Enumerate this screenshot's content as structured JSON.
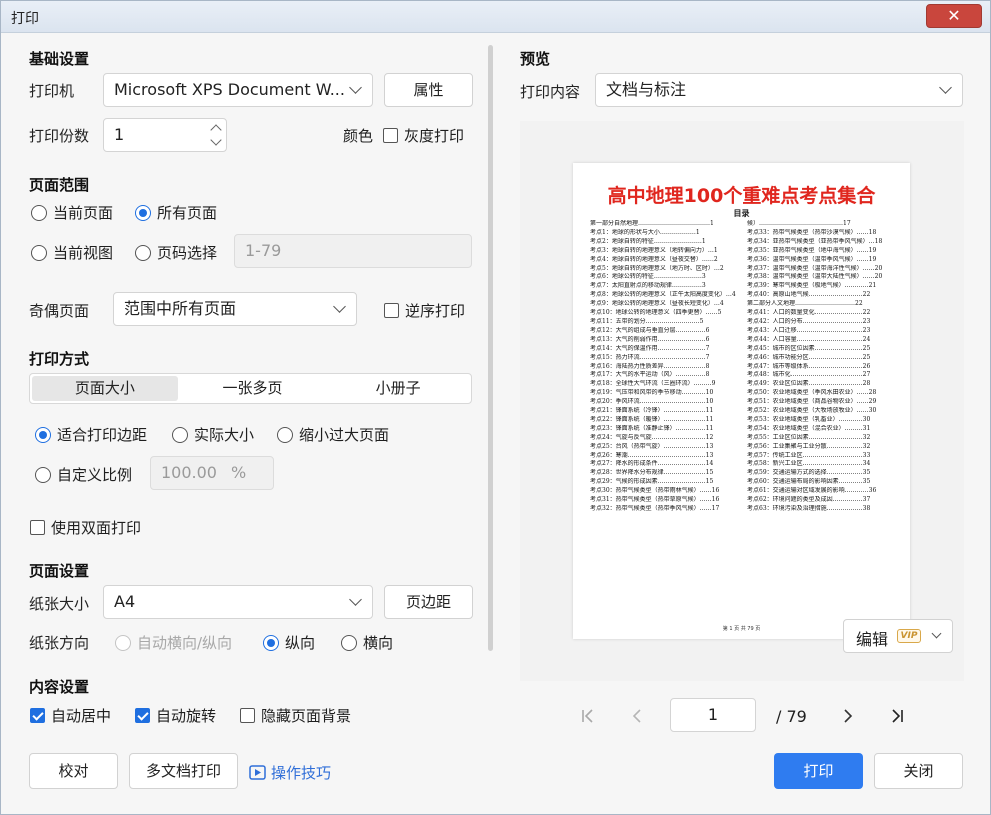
{
  "window": {
    "title": "打印",
    "close_glyph": "✕"
  },
  "basic": {
    "section_title": "基础设置",
    "printer_label": "打印机",
    "printer_value": "Microsoft XPS Document W...",
    "properties_button": "属性",
    "copies_label": "打印份数",
    "copies_value": "1",
    "color_label": "颜色",
    "grayscale_label": "灰度打印"
  },
  "range": {
    "section_title": "页面范围",
    "current_page": "当前页面",
    "all_pages": "所有页面",
    "current_view": "当前视图",
    "page_select": "页码选择",
    "page_select_value": "1-79",
    "odd_even_label": "奇偶页面",
    "odd_even_value": "范围中所有页面",
    "reverse_label": "逆序打印"
  },
  "mode": {
    "section_title": "打印方式",
    "tabs": [
      "页面大小",
      "一张多页",
      "小册子"
    ],
    "fit_margins": "适合打印边距",
    "actual_size": "实际大小",
    "shrink_large": "缩小过大页面",
    "custom_scale": "自定义比例",
    "custom_scale_value": "100.00",
    "percent_unit": "%",
    "duplex_label": "使用双面打印"
  },
  "page_setup": {
    "section_title": "页面设置",
    "paper_size_label": "纸张大小",
    "paper_size_value": "A4",
    "margins_button": "页边距",
    "orientation_label": "纸张方向",
    "auto_orient": "自动横向/纵向",
    "portrait": "纵向",
    "landscape": "横向"
  },
  "content": {
    "section_title": "内容设置",
    "auto_center": "自动居中",
    "auto_rotate": "自动旋转",
    "hide_background": "隐藏页面背景"
  },
  "footer_left": {
    "proof_button": "校对",
    "multi_doc_button": "多文档打印",
    "tips_link": "操作技巧"
  },
  "preview": {
    "section_title": "预览",
    "content_label": "打印内容",
    "content_value": "文档与标注",
    "doc_title": "高中地理100个重难点考点集合",
    "doc_subtitle": "目录",
    "toc_left": [
      "第一部分自然地理………………………………1",
      "考点1：地球的形状与大小………………1",
      "考点2：地球自转的特征……………………1",
      "考点3：地球自转的地理意义（地转偏向力）…1",
      "考点4：地球自转的地理意义（昼夜交替）……2",
      "考点5：地球自转的地理意义（地方时、区时）…2",
      "考点6：地球公转的特征……………………3",
      "考点7：太阳直射点的移动规律……………3",
      "考点8：地球公转的地理意义（正午太阳高度变化）…4",
      "考点9：地球公转的地理意义（昼夜长短变化）…4",
      "考点10：地球公转的地理意义（四季更替）……5",
      "考点11：五带的划分………………………5",
      "考点12：大气的组成与垂直分层……………6",
      "考点13：大气的削弱作用……………………6",
      "考点14：大气的保温作用……………………7",
      "考点15：热力环流……………………………7",
      "考点16：海陆热力性质差异…………………8",
      "考点17：大气的水平运动（风）……………8",
      "考点18：全球性大气环流（三圈环流）………9",
      "考点19：气压带和风带的季节移动…………10",
      "考点20：季风环流……………………………10",
      "考点21：锋面系统（冷锋）…………………11",
      "考点22：锋面系统（暖锋）…………………11",
      "考点23：锋面系统（准静止锋）……………11",
      "考点24：气旋与反气旋………………………12",
      "考点25：台风（热带气旋）…………………13",
      "考点26：寒潮…………………………………13",
      "考点27：降水的形成条件……………………14",
      "考点28：世界降水分布规律…………………15",
      "考点29：气候的形成因素……………………15",
      "考点30：热带气候类型（热带雨林气候）……16",
      "考点31：热带气候类型（热带草原气候）……16",
      "考点32：热带气候类型（热带季风气候）……17"
    ],
    "toc_right": [
      "候）……………………………………17",
      "考点33：热带气候类型（热带沙漠气候）……18",
      "考点34：亚热带气候类型（亚热带季风气候）…18",
      "考点35：亚热带气候类型（地中海气候）……19",
      "考点36：温带气候类型（温带季风气候）……19",
      "考点37：温带气候类型（温带海洋性气候）……20",
      "考点38：温带气候类型（温带大陆性气候）……20",
      "考点39：寒带气候类型（极地气候）…………21",
      "考点40：高原山地气候………………………22",
      "第二部分人文地理…………………………22",
      "考点41：人口的数量变化……………………22",
      "考点42：人口的分布…………………………23",
      "考点43：人口迁移……………………………23",
      "考点44：人口容量……………………………24",
      "考点45：城市的区位因素……………………25",
      "考点46：城市功能分区………………………25",
      "考点47：城市等级体系………………………26",
      "考点48：城市化………………………………27",
      "考点49：农业区位因素………………………28",
      "考点50：农业地域类型（季风水田农业）……28",
      "考点51：农业地域类型（商品谷物农业）……29",
      "考点52：农业地域类型（大牧场放牧业）……30",
      "考点53：农业地域类型（乳畜业）…………30",
      "考点54：农业地域类型（混合农业）………31",
      "考点55：工业区位因素………………………32",
      "考点56：工业集聚与工业分散………………32",
      "考点57：传统工业区…………………………33",
      "考点58：新兴工业区…………………………34",
      "考点59：交通运输方式的选择………………35",
      "考点60：交通运输布局的影响因素…………35",
      "考点61：交通运输对区域发展的影响…………36",
      "考点62：环境问题的类型及成因……………37",
      "考点63：环境污染及治理措施………………38"
    ],
    "doc_footer": "第 1 页 共 79 页",
    "edit_button": "编辑",
    "vip_badge": "VIP",
    "current_page": "1",
    "total_pages": "/  79"
  },
  "actions": {
    "print_button": "打印",
    "close_button": "关闭"
  },
  "colors": {
    "accent": "#2f7cf0",
    "title_red": "#e0261e",
    "close_red": "#c9463d"
  }
}
